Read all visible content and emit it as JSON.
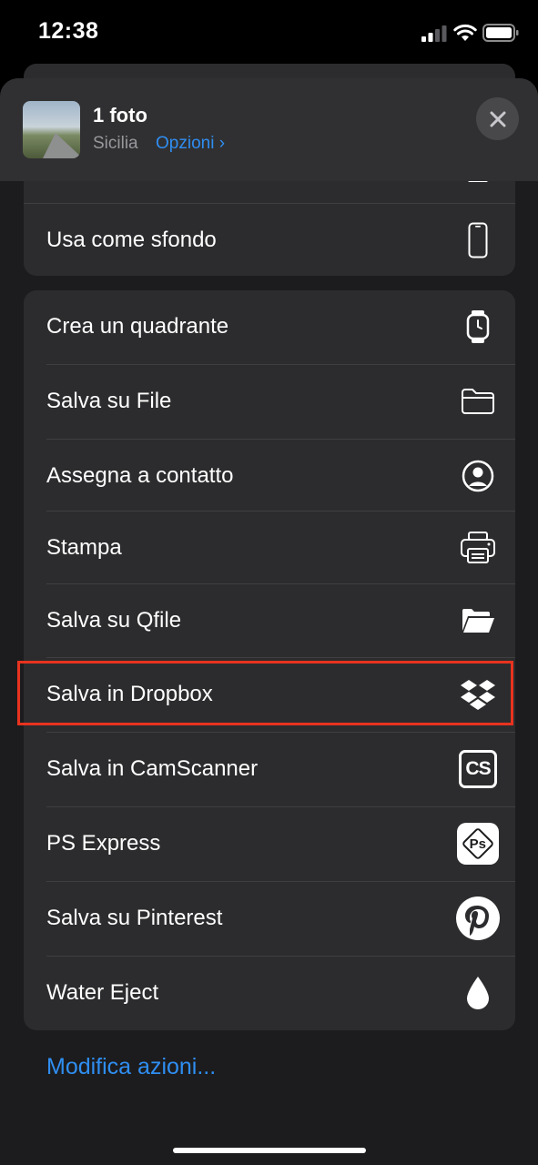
{
  "status_bar": {
    "time": "12:38"
  },
  "header": {
    "title": "1 foto",
    "subtitle": "Sicilia",
    "options_label": "Opzioni ›"
  },
  "top_group": [
    {
      "label": "Usa come sfondo",
      "icon": "phone-icon"
    }
  ],
  "actions": [
    {
      "label": "Crea un quadrante",
      "icon": "watch-icon"
    },
    {
      "label": "Salva su File",
      "icon": "folder-icon"
    },
    {
      "label": "Assegna a contatto",
      "icon": "contact-icon"
    },
    {
      "label": "Stampa",
      "icon": "printer-icon"
    },
    {
      "label": "Salva su Qfile",
      "icon": "open-folder-icon"
    },
    {
      "label": "Salva in Dropbox",
      "icon": "dropbox-icon",
      "highlighted": true
    },
    {
      "label": "Salva in CamScanner",
      "icon": "camscanner-icon",
      "icon_text": "CS"
    },
    {
      "label": "PS Express",
      "icon": "ps-express-icon",
      "icon_text": "Ps"
    },
    {
      "label": "Salva su Pinterest",
      "icon": "pinterest-icon"
    },
    {
      "label": "Water Eject",
      "icon": "water-drop-icon"
    }
  ],
  "footer": {
    "edit_actions": "Modifica azioni..."
  },
  "colors": {
    "accent": "#2f8ef2",
    "highlight": "#e8331f",
    "background": "#1c1c1e",
    "card": "#2c2c2e"
  }
}
